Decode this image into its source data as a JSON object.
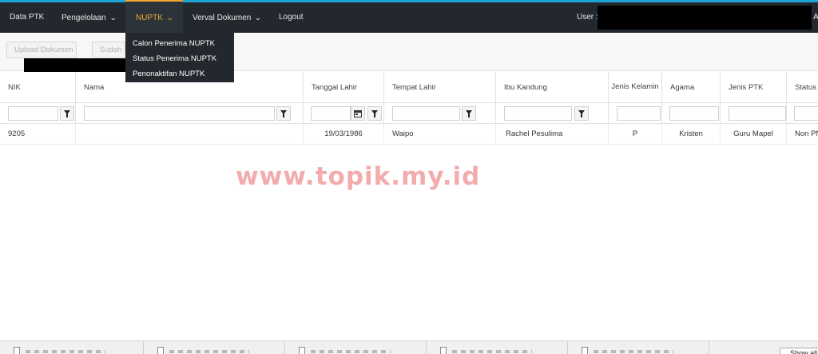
{
  "nav": {
    "data_ptk": "Data PTK",
    "pengelolaan": "Pengelolaan",
    "nuptk": "NUPTK",
    "verval": "Verval Dokumen",
    "logout": "Logout",
    "user_label": "User :",
    "user_tail": "A A"
  },
  "dropdown": {
    "items": [
      "Calon Penerima NUPTK",
      "Status Penerima NUPTK",
      "Penonaktifan NUPTK"
    ]
  },
  "toolbar": {
    "upload": "Upload Dokumen",
    "sudah": "Sudah"
  },
  "table": {
    "columns": [
      "NIK",
      "Nama",
      "Tanggal Lahir",
      "Tempat Lahir",
      "Ibu Kandung",
      "Jenis Kelamin",
      "Agama",
      "Jenis PTK",
      "Status"
    ],
    "rows": [
      {
        "nik": "9205",
        "nama": "",
        "tanggal_lahir": "19/03/1986",
        "tempat_lahir": "Waipo",
        "ibu_kandung": "Rachel Pesulima",
        "jenis_kelamin": "P",
        "agama": "Kristen",
        "jenis_ptk": "Guru Mapel",
        "status": "Non PNS"
      }
    ]
  },
  "watermark": "www.topik.my.id",
  "bottom": {
    "show_all": "Show all"
  },
  "colors": {
    "navbar": "#22282d",
    "accent": "#f3a833",
    "watermark": "#f3a2a2"
  }
}
